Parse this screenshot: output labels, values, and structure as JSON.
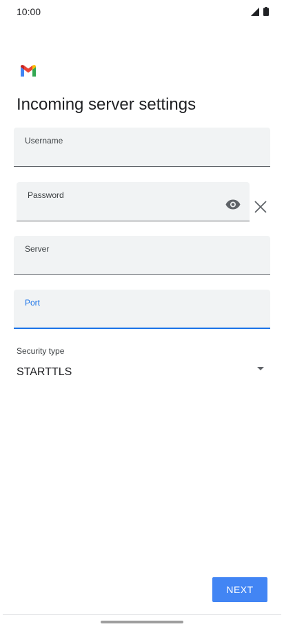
{
  "status_bar": {
    "time": "10:00",
    "icons": [
      "signal-icon",
      "battery-icon"
    ]
  },
  "app": {
    "logo": "gmail-logo"
  },
  "page": {
    "title": "Incoming server settings"
  },
  "form": {
    "username": {
      "label": "Username",
      "value": ""
    },
    "password": {
      "label": "Password",
      "value": "",
      "icons": [
        "eye-icon",
        "close-icon"
      ]
    },
    "server": {
      "label": "Server",
      "value": ""
    },
    "port": {
      "label": "Port",
      "value": "",
      "focused": true
    },
    "security_type": {
      "label": "Security type",
      "value": "STARTTLS",
      "icon": "dropdown-arrow-icon"
    }
  },
  "actions": {
    "next_label": "NEXT"
  },
  "colors": {
    "accent": "#1a73e8",
    "button": "#4285f4",
    "field_background": "#f1f3f4"
  }
}
